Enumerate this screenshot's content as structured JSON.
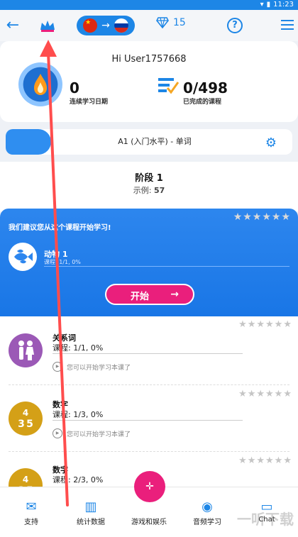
{
  "status": {
    "time": "11:23"
  },
  "topbar": {
    "back_icon": "arrow-left-icon",
    "crown_icon": "crown-icon",
    "lang_from": "cn-flag",
    "lang_to": "ru-flag",
    "gem_count": "15",
    "help_icon": "help-icon",
    "menu_icon": "menu-icon"
  },
  "profile": {
    "greeting": "Hi User1757668",
    "streak_value": "0",
    "streak_label": "连续学习日期",
    "lessons_value": "0/498",
    "lessons_label": "已完成的课程"
  },
  "level": {
    "label": "A1 (入门水平) - 单词"
  },
  "stage": {
    "title": "阶段 1",
    "sample_label": "示例:",
    "sample_value": "57"
  },
  "recommend": {
    "hint": "我们建议您从这个课程开始学习!",
    "lesson_title": "动物 1",
    "lesson_sub": "课程: 1/1, 0%",
    "start_label": "开始",
    "start_arrow": "→"
  },
  "lessons": [
    {
      "title": "关系词",
      "progress": "课程: 1/1, 0%",
      "note": "您可以开始学习本课了"
    },
    {
      "title": "数字",
      "progress": "课程: 1/3, 0%",
      "note": "您可以开始学习本课了"
    },
    {
      "title": "数字",
      "progress": "课程: 2/3, 0%"
    }
  ],
  "bottomnav": {
    "support": "支持",
    "stats": "统计数据",
    "games": "游戏和娱乐",
    "audio": "音频学习",
    "chat": "Chat"
  },
  "watermark": "一听下载"
}
